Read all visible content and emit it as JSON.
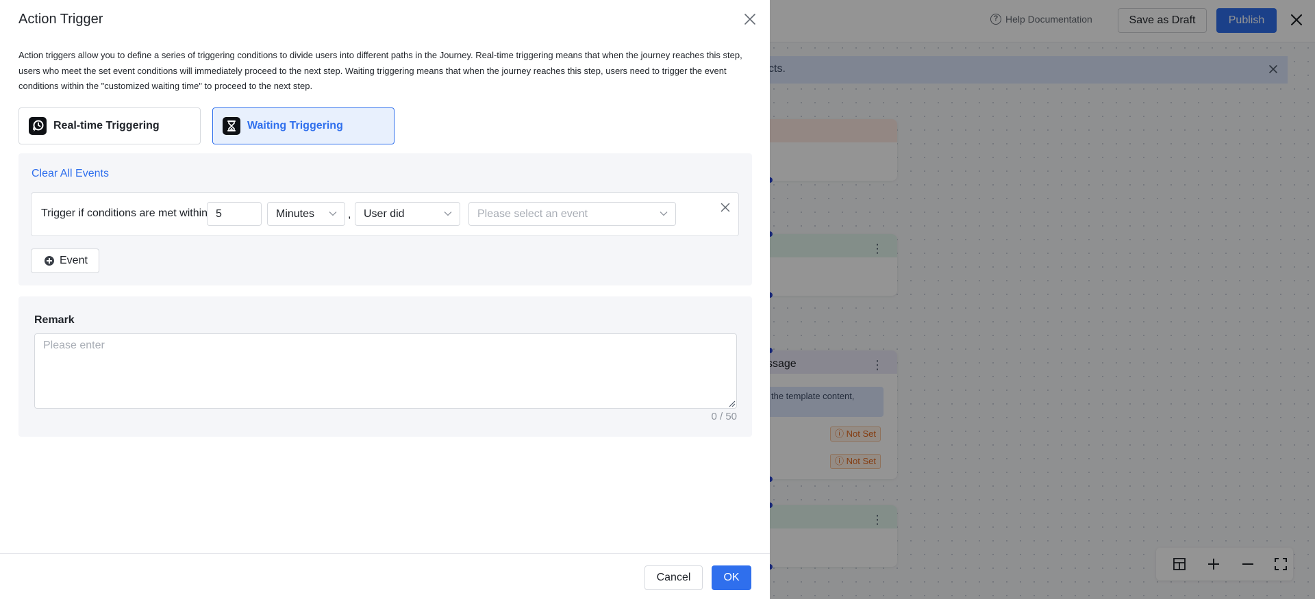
{
  "background": {
    "header": {
      "help_label": "Help Documentation",
      "save_draft_label": "Save as Draft",
      "publish_label": "Publish"
    },
    "banner_text": "cts.",
    "message_card": {
      "title": "ssage",
      "template_text": "the template content,",
      "badge_1": "Not Set",
      "badge_2": "Not Set"
    },
    "colors": {
      "accent": "#2f6fed",
      "warning": "#e36a1f"
    }
  },
  "drawer": {
    "title": "Action Trigger",
    "description": "Action triggers allow you to define a series of triggering conditions to divide users into different paths in the Journey. Real-time triggering means that when the journey reaches this step, users who meet the set event conditions will immediately proceed to the next step. Waiting triggering means that when the journey reaches this step, users need to trigger the event conditions within the \"customized waiting time\" to proceed to the next step.",
    "trigger_types": [
      {
        "label": "Real-time Triggering",
        "icon": "clock-lightning-icon",
        "selected": false
      },
      {
        "label": "Waiting Triggering",
        "icon": "hourglass-icon",
        "selected": true
      }
    ],
    "events": {
      "clear_all_label": "Clear All Events",
      "condition": {
        "prefix_label": "Trigger if conditions are met within",
        "duration_value": "5",
        "unit_selected": "Minutes",
        "separator": ",",
        "actor_selected": "User did",
        "event_placeholder": "Please select an event"
      },
      "add_event_label": "Event"
    },
    "remark": {
      "label": "Remark",
      "placeholder": "Please enter",
      "counter": "0 / 50"
    },
    "footer": {
      "cancel_label": "Cancel",
      "ok_label": "OK"
    }
  }
}
